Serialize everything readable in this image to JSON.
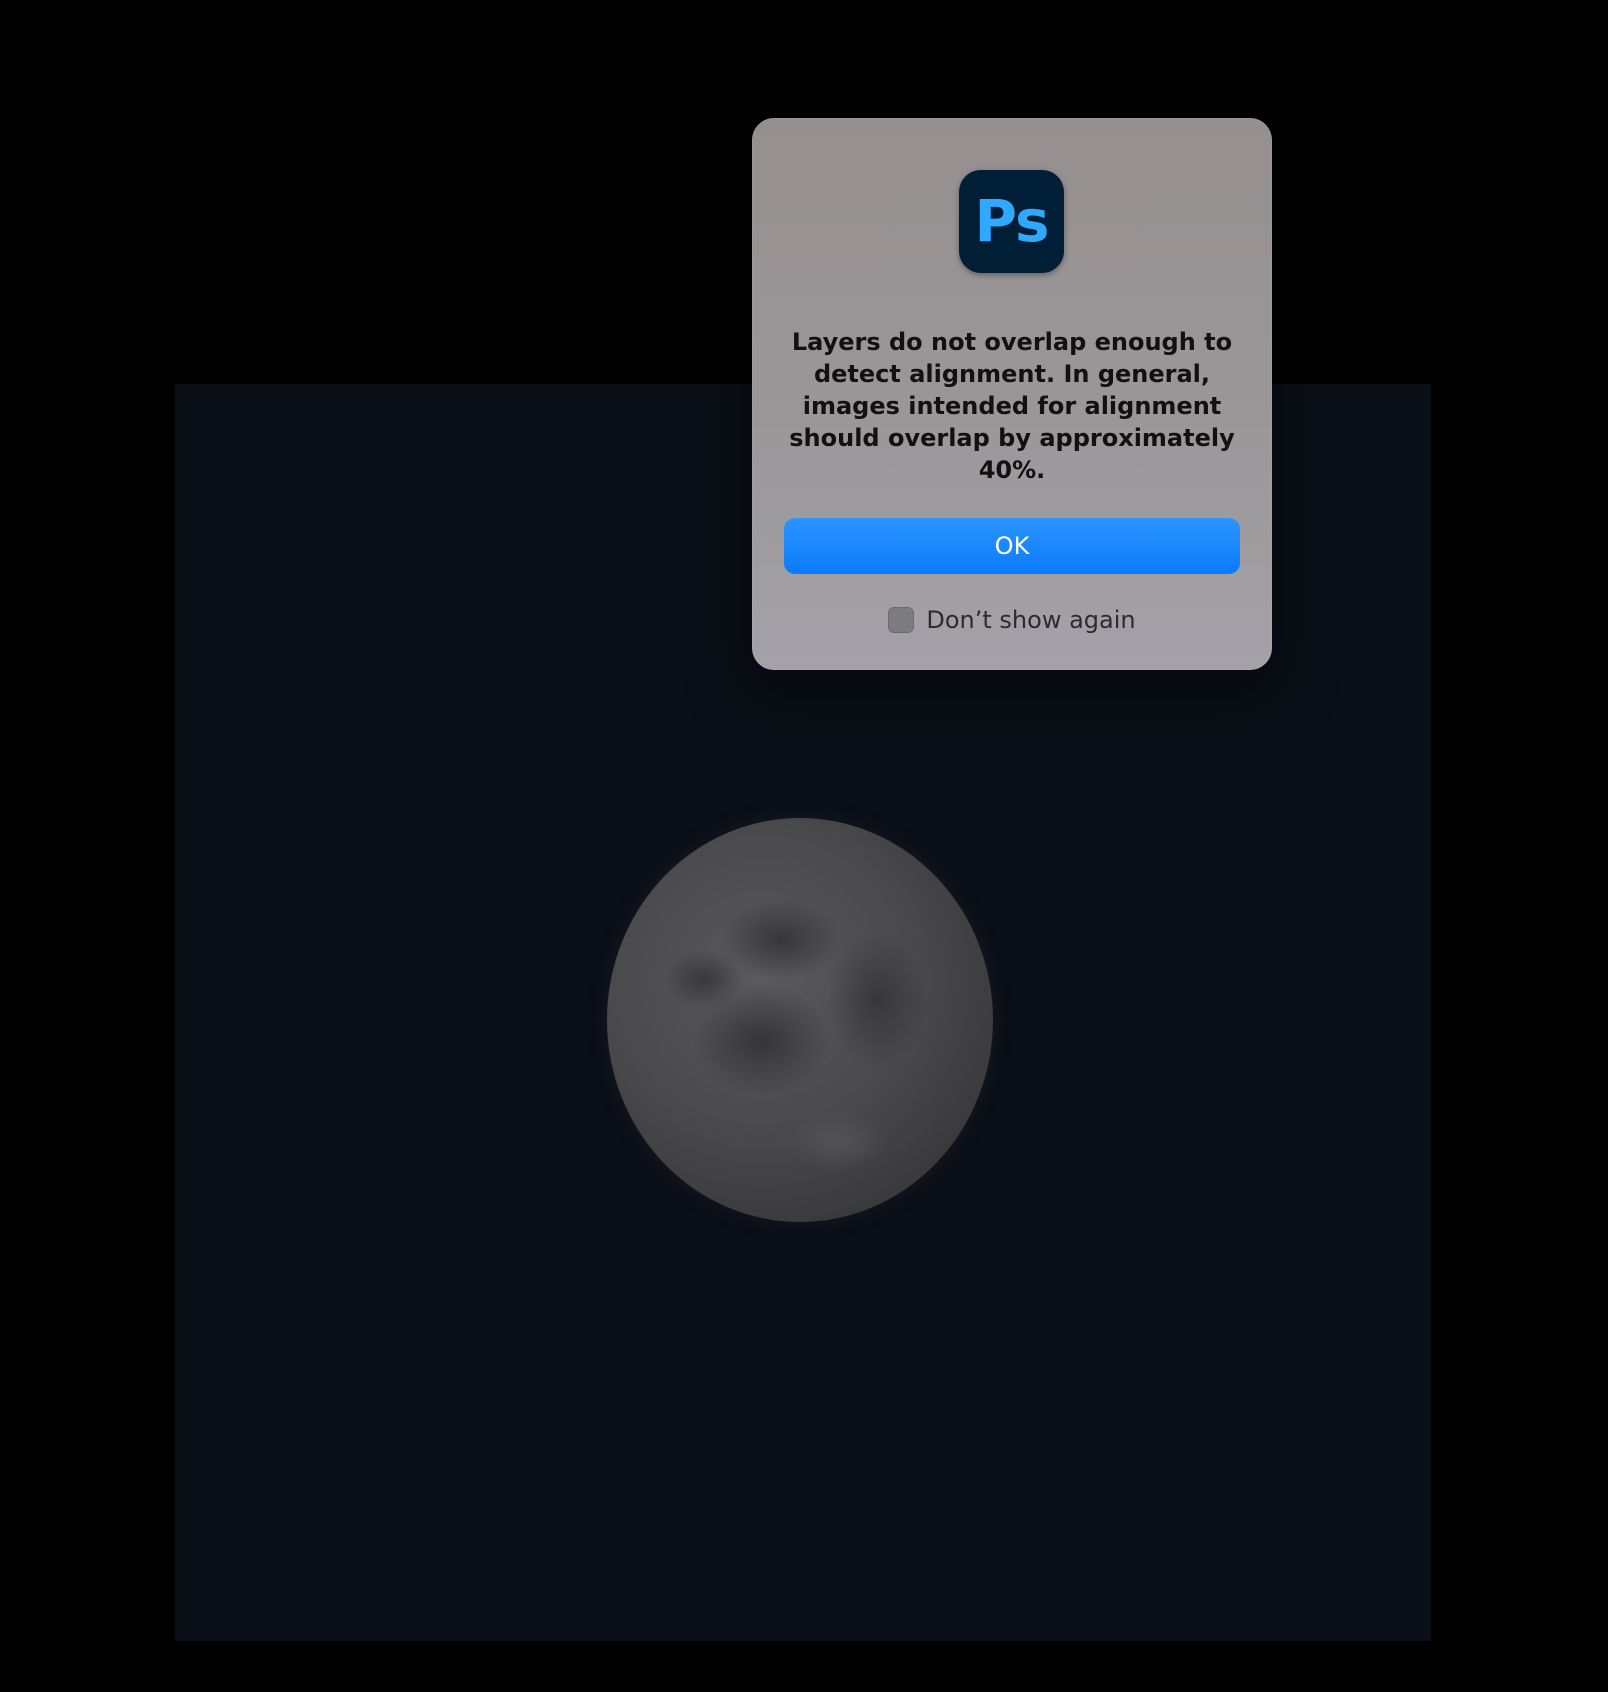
{
  "app": {
    "icon_label": "Ps",
    "icon_name": "photoshop-app-icon",
    "icon_bg_color": "#001e36",
    "icon_fg_color": "#31a8ff"
  },
  "dialog": {
    "message": "Layers do not overlap enough to detect alignment. In general, images intended for alignment should overlap by approximately 40%.",
    "ok_label": "OK",
    "dont_show_label": "Don’t show again",
    "dont_show_checked": false,
    "accent_color": "#0a7bfb"
  },
  "canvas": {
    "content": "moon-photo",
    "background_color": "#0a0f17"
  }
}
